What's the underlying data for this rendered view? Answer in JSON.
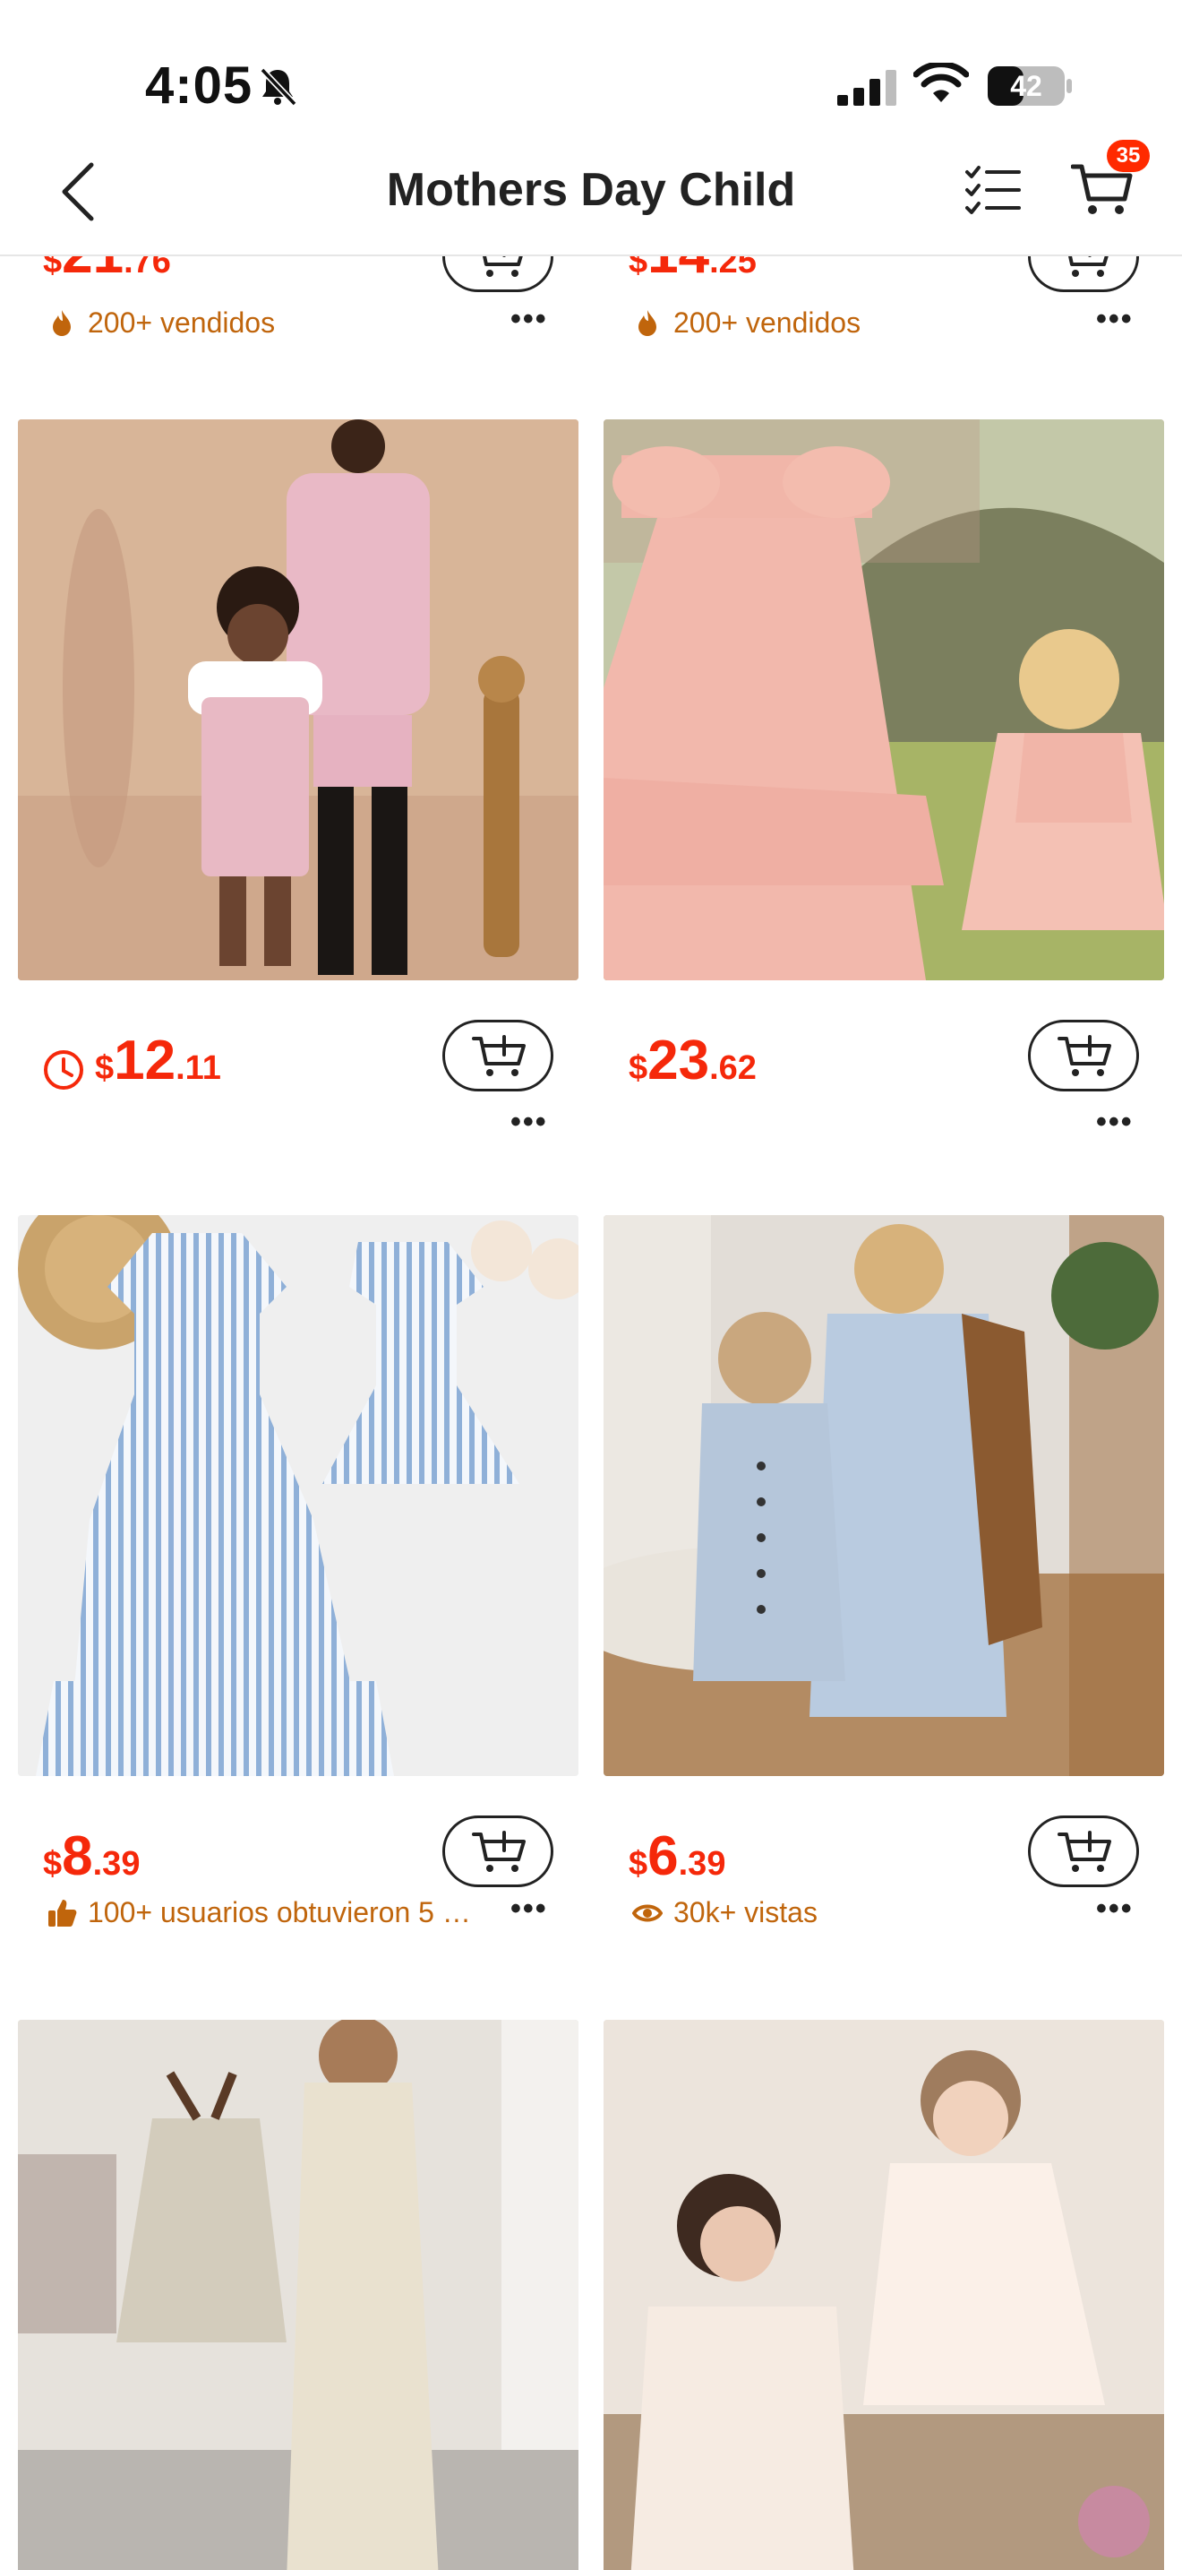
{
  "status_bar": {
    "time": "4:05",
    "battery": "42",
    "icons": [
      "bell-off-icon",
      "signal-icon",
      "wifi-icon",
      "battery-icon"
    ]
  },
  "header": {
    "title": "Mothers Day Child",
    "cart_badge": "35",
    "icons": [
      "back-chevron-icon",
      "checklist-icon",
      "cart-icon"
    ]
  },
  "colors": {
    "price": "#f5280a",
    "meta": "#c0650c",
    "badge": "#ff2a00"
  },
  "products_top_partial": [
    {
      "price_cur": "$",
      "price_int": "21",
      "price_dec": ".76",
      "meta_icon": "fire-icon",
      "meta": "200+ vendidos"
    },
    {
      "price_cur": "$",
      "price_int": "14",
      "price_dec": ".25",
      "meta_icon": "fire-icon",
      "meta": "200+ vendidos"
    }
  ],
  "products": [
    {
      "price_cur": "$",
      "price_int": "12",
      "price_dec": ".11",
      "has_timer": true,
      "meta": ""
    },
    {
      "price_cur": "$",
      "price_int": "23",
      "price_dec": ".62",
      "has_timer": false,
      "meta": ""
    },
    {
      "price_cur": "$",
      "price_int": "8",
      "price_dec": ".39",
      "meta_icon": "thumbs-up-icon",
      "meta": "100+ usuarios obtuvieron 5 …"
    },
    {
      "price_cur": "$",
      "price_int": "6",
      "price_dec": ".39",
      "meta_icon": "eye-icon",
      "meta": "30k+ vistas"
    }
  ]
}
